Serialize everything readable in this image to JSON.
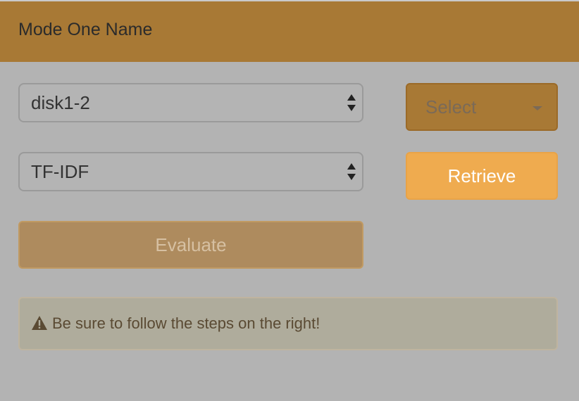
{
  "header": {
    "title": "Mode One Name"
  },
  "form": {
    "dataset_value": "disk1-2",
    "model_value": "TF-IDF",
    "select_label": "Select",
    "retrieve_label": "Retrieve",
    "evaluate_label": "Evaluate"
  },
  "alert": {
    "icon": "warning-icon",
    "text": "Be sure to follow the steps on the right!"
  },
  "colors": {
    "header_bg": "#a87935",
    "page_bg": "#b3b3b3",
    "retrieve_bg": "#efab4f",
    "evaluate_bg": "#ae8b5e",
    "alert_bg": "#afac9c"
  }
}
